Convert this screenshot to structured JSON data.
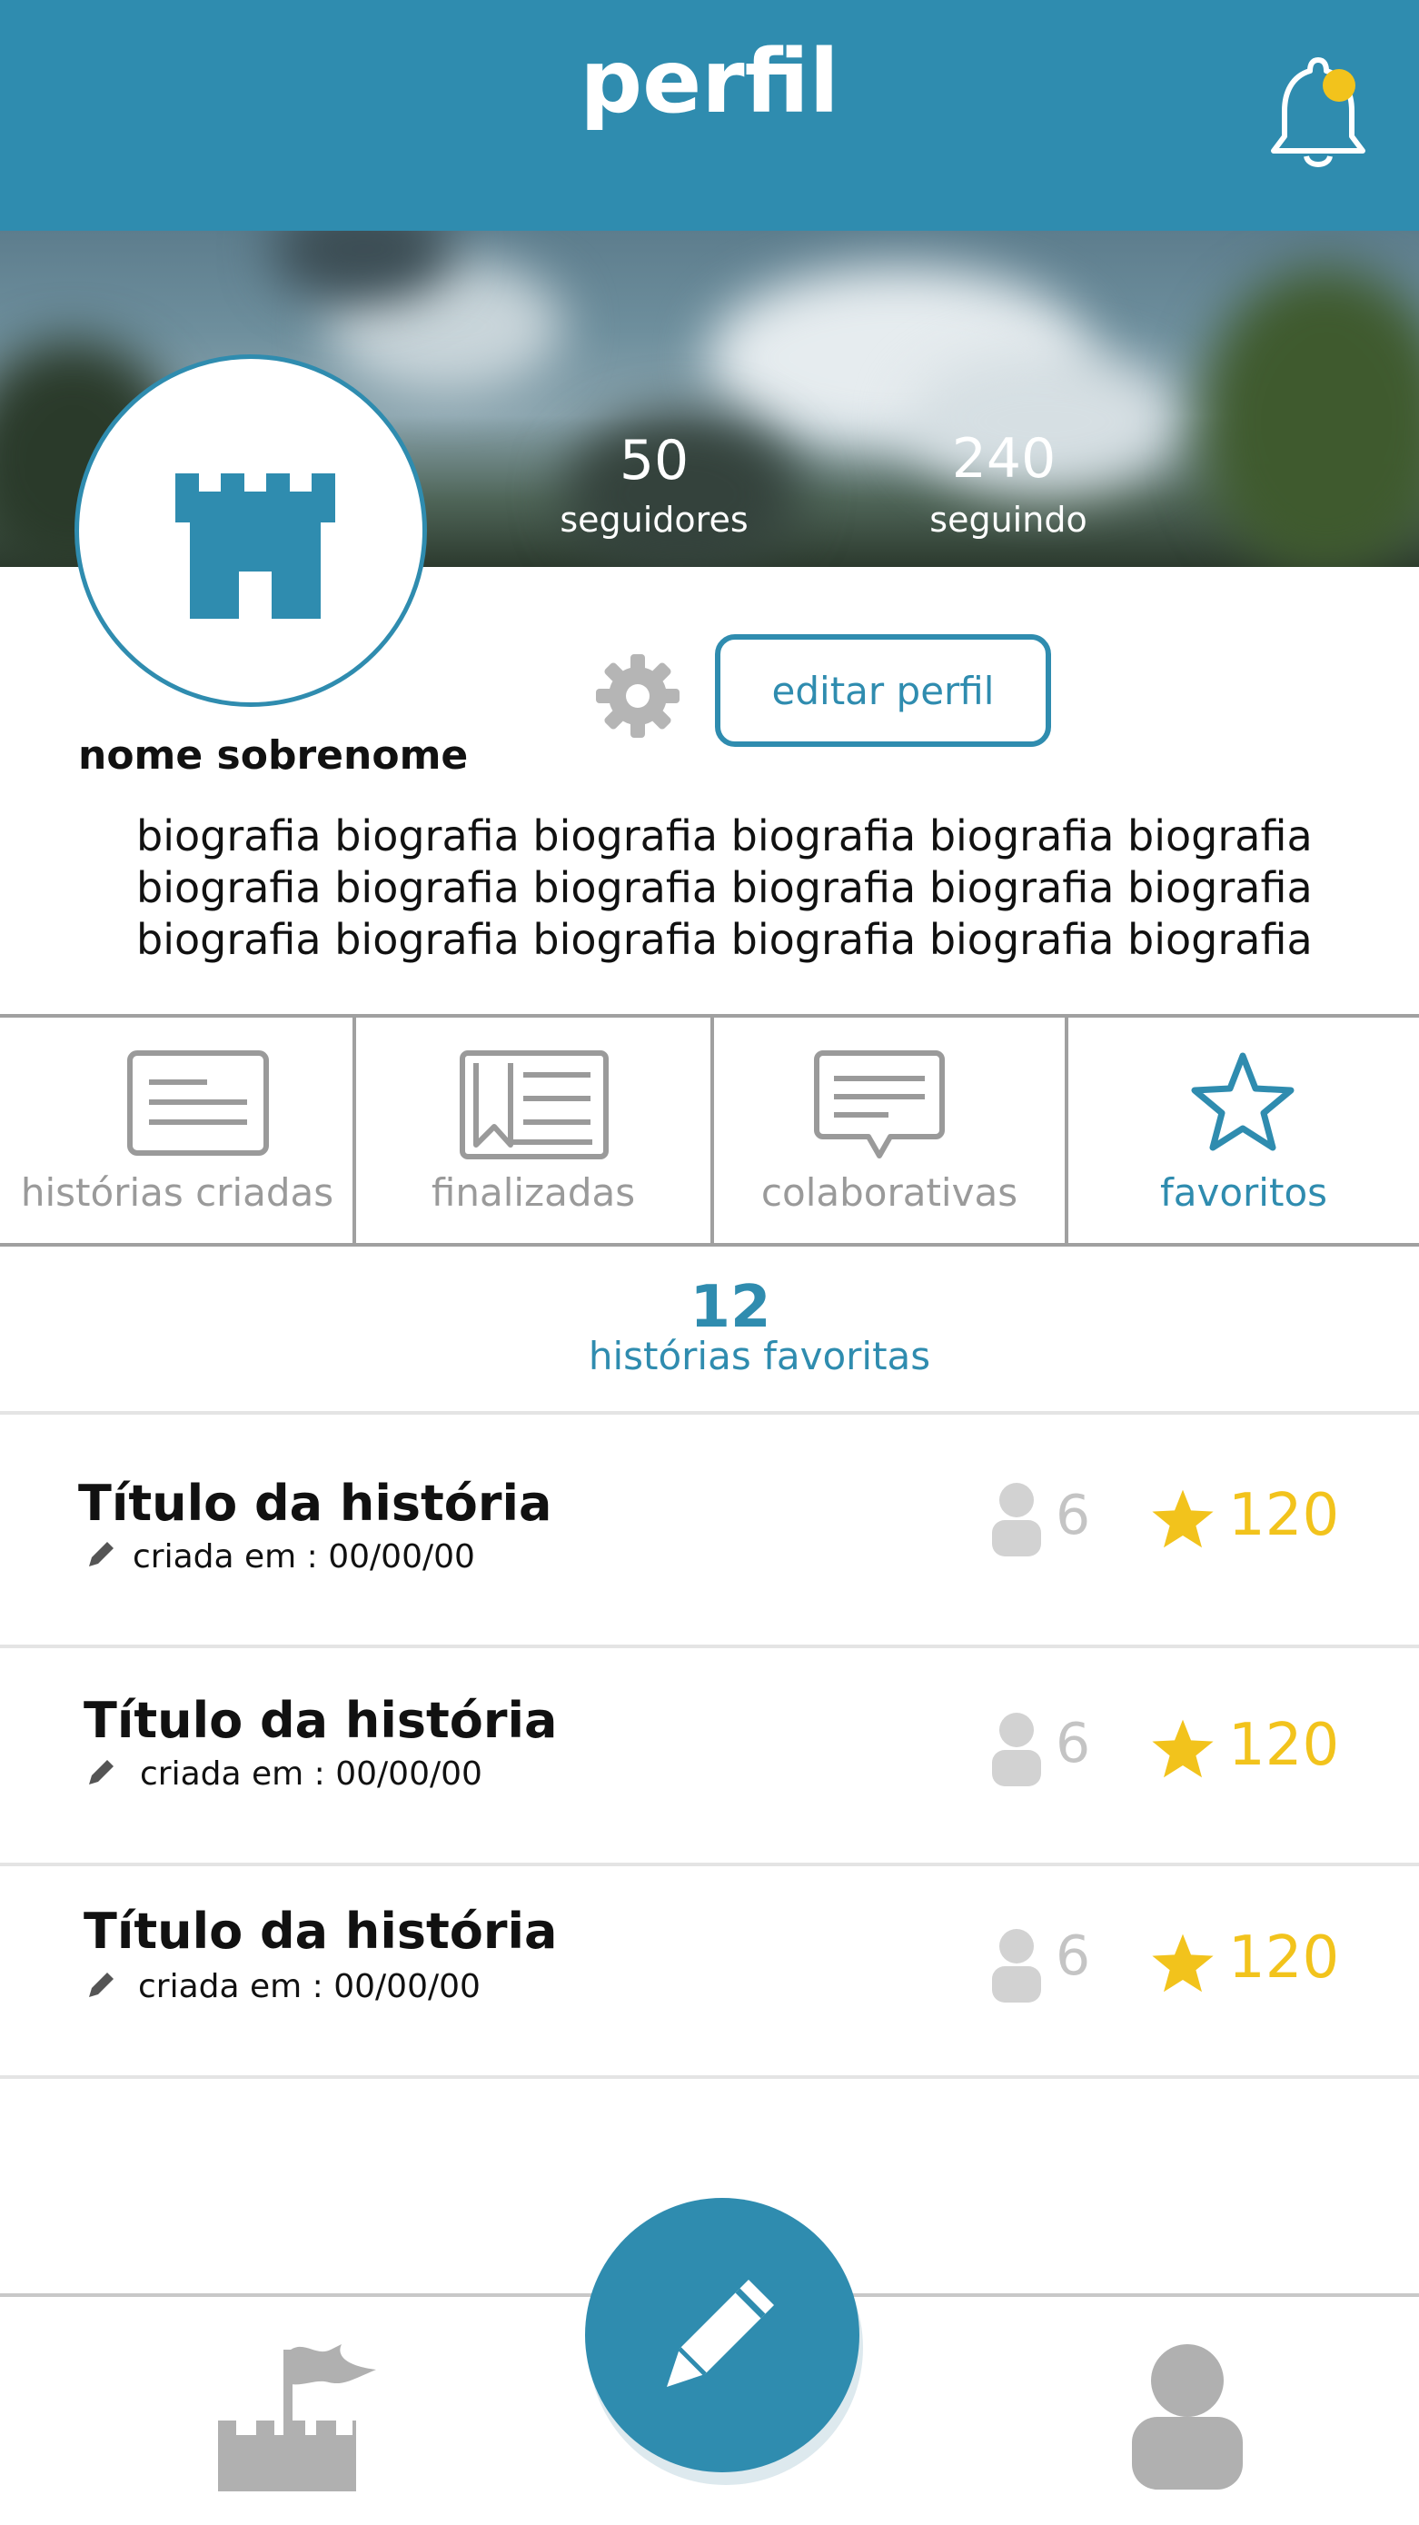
{
  "header": {
    "title": "perfil",
    "notification_icon": "bell-icon",
    "notification_dot_color": "#f2c31c"
  },
  "profile": {
    "followers_count": "50",
    "followers_label": "seguidores",
    "following_count": "240",
    "following_label": "seguindo",
    "name": "nome sobrenome",
    "edit_button": "editar perfil",
    "avatar_icon": "castle-icon",
    "bio_lines": [
      "biografia biografia biografia biografia biografia biografia",
      "biografia biografia biografia biografia biografia biografia",
      "biografia biografia biografia biografia biografia biografia"
    ]
  },
  "tabs": [
    {
      "label": "histórias criadas",
      "icon": "document-icon"
    },
    {
      "label": "finalizadas",
      "icon": "book-icon"
    },
    {
      "label": "colaborativas",
      "icon": "chat-bubble-icon"
    },
    {
      "label": "favoritos",
      "icon": "star-icon",
      "active": true
    }
  ],
  "favorites": {
    "count": "12",
    "label": "histórias favoritas"
  },
  "stories": [
    {
      "title": "Título da história",
      "date": "criada em : 00/00/00",
      "collaborators": "6",
      "stars": "120"
    },
    {
      "title": "Título da história",
      "date": "criada em : 00/00/00",
      "collaborators": "6",
      "stars": "120"
    },
    {
      "title": "Título da história",
      "date": "criada em : 00/00/00",
      "collaborators": "6",
      "stars": "120"
    }
  ],
  "colors": {
    "primary": "#2f8caf",
    "gold": "#f2c31c",
    "gray": "#a8a8a8"
  },
  "bottom_nav": {
    "left_icon": "castle-flag-icon",
    "center_icon": "pencil-icon",
    "right_icon": "user-icon"
  }
}
